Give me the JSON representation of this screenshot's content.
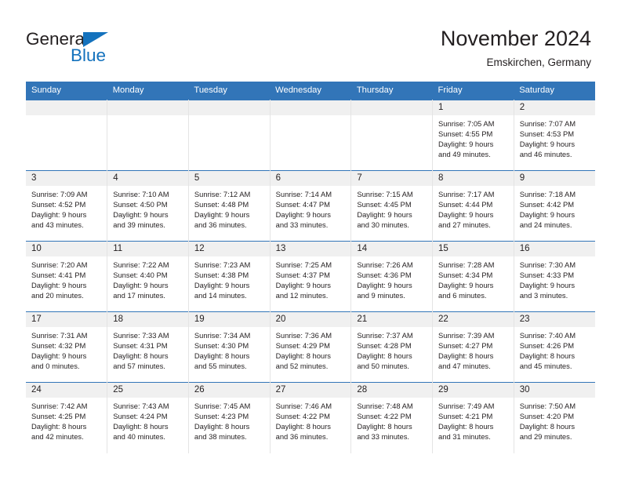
{
  "brand": {
    "name_part1": "General",
    "name_part2": "Blue",
    "triangle_icon": "triangle-icon",
    "accent_color": "#1472bd"
  },
  "header": {
    "title": "November 2024",
    "subtitle": "Emskirchen, Germany"
  },
  "theme": {
    "header_blue": "#3275b8",
    "band_gray": "#f0f0f0",
    "text": "#231f20"
  },
  "calendar": {
    "weekday_headers": [
      "Sunday",
      "Monday",
      "Tuesday",
      "Wednesday",
      "Thursday",
      "Friday",
      "Saturday"
    ],
    "labels": {
      "sunrise": "Sunrise:",
      "sunset": "Sunset:",
      "daylight": "Daylight:"
    },
    "weeks": [
      [
        {
          "day": "",
          "empty": true
        },
        {
          "day": "",
          "empty": true
        },
        {
          "day": "",
          "empty": true
        },
        {
          "day": "",
          "empty": true
        },
        {
          "day": "",
          "empty": true
        },
        {
          "day": "1",
          "sunrise": "Sunrise: 7:05 AM",
          "sunset": "Sunset: 4:55 PM",
          "daylight_line1": "Daylight: 9 hours",
          "daylight_line2": "and 49 minutes."
        },
        {
          "day": "2",
          "sunrise": "Sunrise: 7:07 AM",
          "sunset": "Sunset: 4:53 PM",
          "daylight_line1": "Daylight: 9 hours",
          "daylight_line2": "and 46 minutes."
        }
      ],
      [
        {
          "day": "3",
          "sunrise": "Sunrise: 7:09 AM",
          "sunset": "Sunset: 4:52 PM",
          "daylight_line1": "Daylight: 9 hours",
          "daylight_line2": "and 43 minutes."
        },
        {
          "day": "4",
          "sunrise": "Sunrise: 7:10 AM",
          "sunset": "Sunset: 4:50 PM",
          "daylight_line1": "Daylight: 9 hours",
          "daylight_line2": "and 39 minutes."
        },
        {
          "day": "5",
          "sunrise": "Sunrise: 7:12 AM",
          "sunset": "Sunset: 4:48 PM",
          "daylight_line1": "Daylight: 9 hours",
          "daylight_line2": "and 36 minutes."
        },
        {
          "day": "6",
          "sunrise": "Sunrise: 7:14 AM",
          "sunset": "Sunset: 4:47 PM",
          "daylight_line1": "Daylight: 9 hours",
          "daylight_line2": "and 33 minutes."
        },
        {
          "day": "7",
          "sunrise": "Sunrise: 7:15 AM",
          "sunset": "Sunset: 4:45 PM",
          "daylight_line1": "Daylight: 9 hours",
          "daylight_line2": "and 30 minutes."
        },
        {
          "day": "8",
          "sunrise": "Sunrise: 7:17 AM",
          "sunset": "Sunset: 4:44 PM",
          "daylight_line1": "Daylight: 9 hours",
          "daylight_line2": "and 27 minutes."
        },
        {
          "day": "9",
          "sunrise": "Sunrise: 7:18 AM",
          "sunset": "Sunset: 4:42 PM",
          "daylight_line1": "Daylight: 9 hours",
          "daylight_line2": "and 24 minutes."
        }
      ],
      [
        {
          "day": "10",
          "sunrise": "Sunrise: 7:20 AM",
          "sunset": "Sunset: 4:41 PM",
          "daylight_line1": "Daylight: 9 hours",
          "daylight_line2": "and 20 minutes."
        },
        {
          "day": "11",
          "sunrise": "Sunrise: 7:22 AM",
          "sunset": "Sunset: 4:40 PM",
          "daylight_line1": "Daylight: 9 hours",
          "daylight_line2": "and 17 minutes."
        },
        {
          "day": "12",
          "sunrise": "Sunrise: 7:23 AM",
          "sunset": "Sunset: 4:38 PM",
          "daylight_line1": "Daylight: 9 hours",
          "daylight_line2": "and 14 minutes."
        },
        {
          "day": "13",
          "sunrise": "Sunrise: 7:25 AM",
          "sunset": "Sunset: 4:37 PM",
          "daylight_line1": "Daylight: 9 hours",
          "daylight_line2": "and 12 minutes."
        },
        {
          "day": "14",
          "sunrise": "Sunrise: 7:26 AM",
          "sunset": "Sunset: 4:36 PM",
          "daylight_line1": "Daylight: 9 hours",
          "daylight_line2": "and 9 minutes."
        },
        {
          "day": "15",
          "sunrise": "Sunrise: 7:28 AM",
          "sunset": "Sunset: 4:34 PM",
          "daylight_line1": "Daylight: 9 hours",
          "daylight_line2": "and 6 minutes."
        },
        {
          "day": "16",
          "sunrise": "Sunrise: 7:30 AM",
          "sunset": "Sunset: 4:33 PM",
          "daylight_line1": "Daylight: 9 hours",
          "daylight_line2": "and 3 minutes."
        }
      ],
      [
        {
          "day": "17",
          "sunrise": "Sunrise: 7:31 AM",
          "sunset": "Sunset: 4:32 PM",
          "daylight_line1": "Daylight: 9 hours",
          "daylight_line2": "and 0 minutes."
        },
        {
          "day": "18",
          "sunrise": "Sunrise: 7:33 AM",
          "sunset": "Sunset: 4:31 PM",
          "daylight_line1": "Daylight: 8 hours",
          "daylight_line2": "and 57 minutes."
        },
        {
          "day": "19",
          "sunrise": "Sunrise: 7:34 AM",
          "sunset": "Sunset: 4:30 PM",
          "daylight_line1": "Daylight: 8 hours",
          "daylight_line2": "and 55 minutes."
        },
        {
          "day": "20",
          "sunrise": "Sunrise: 7:36 AM",
          "sunset": "Sunset: 4:29 PM",
          "daylight_line1": "Daylight: 8 hours",
          "daylight_line2": "and 52 minutes."
        },
        {
          "day": "21",
          "sunrise": "Sunrise: 7:37 AM",
          "sunset": "Sunset: 4:28 PM",
          "daylight_line1": "Daylight: 8 hours",
          "daylight_line2": "and 50 minutes."
        },
        {
          "day": "22",
          "sunrise": "Sunrise: 7:39 AM",
          "sunset": "Sunset: 4:27 PM",
          "daylight_line1": "Daylight: 8 hours",
          "daylight_line2": "and 47 minutes."
        },
        {
          "day": "23",
          "sunrise": "Sunrise: 7:40 AM",
          "sunset": "Sunset: 4:26 PM",
          "daylight_line1": "Daylight: 8 hours",
          "daylight_line2": "and 45 minutes."
        }
      ],
      [
        {
          "day": "24",
          "sunrise": "Sunrise: 7:42 AM",
          "sunset": "Sunset: 4:25 PM",
          "daylight_line1": "Daylight: 8 hours",
          "daylight_line2": "and 42 minutes."
        },
        {
          "day": "25",
          "sunrise": "Sunrise: 7:43 AM",
          "sunset": "Sunset: 4:24 PM",
          "daylight_line1": "Daylight: 8 hours",
          "daylight_line2": "and 40 minutes."
        },
        {
          "day": "26",
          "sunrise": "Sunrise: 7:45 AM",
          "sunset": "Sunset: 4:23 PM",
          "daylight_line1": "Daylight: 8 hours",
          "daylight_line2": "and 38 minutes."
        },
        {
          "day": "27",
          "sunrise": "Sunrise: 7:46 AM",
          "sunset": "Sunset: 4:22 PM",
          "daylight_line1": "Daylight: 8 hours",
          "daylight_line2": "and 36 minutes."
        },
        {
          "day": "28",
          "sunrise": "Sunrise: 7:48 AM",
          "sunset": "Sunset: 4:22 PM",
          "daylight_line1": "Daylight: 8 hours",
          "daylight_line2": "and 33 minutes."
        },
        {
          "day": "29",
          "sunrise": "Sunrise: 7:49 AM",
          "sunset": "Sunset: 4:21 PM",
          "daylight_line1": "Daylight: 8 hours",
          "daylight_line2": "and 31 minutes."
        },
        {
          "day": "30",
          "sunrise": "Sunrise: 7:50 AM",
          "sunset": "Sunset: 4:20 PM",
          "daylight_line1": "Daylight: 8 hours",
          "daylight_line2": "and 29 minutes."
        }
      ]
    ]
  }
}
